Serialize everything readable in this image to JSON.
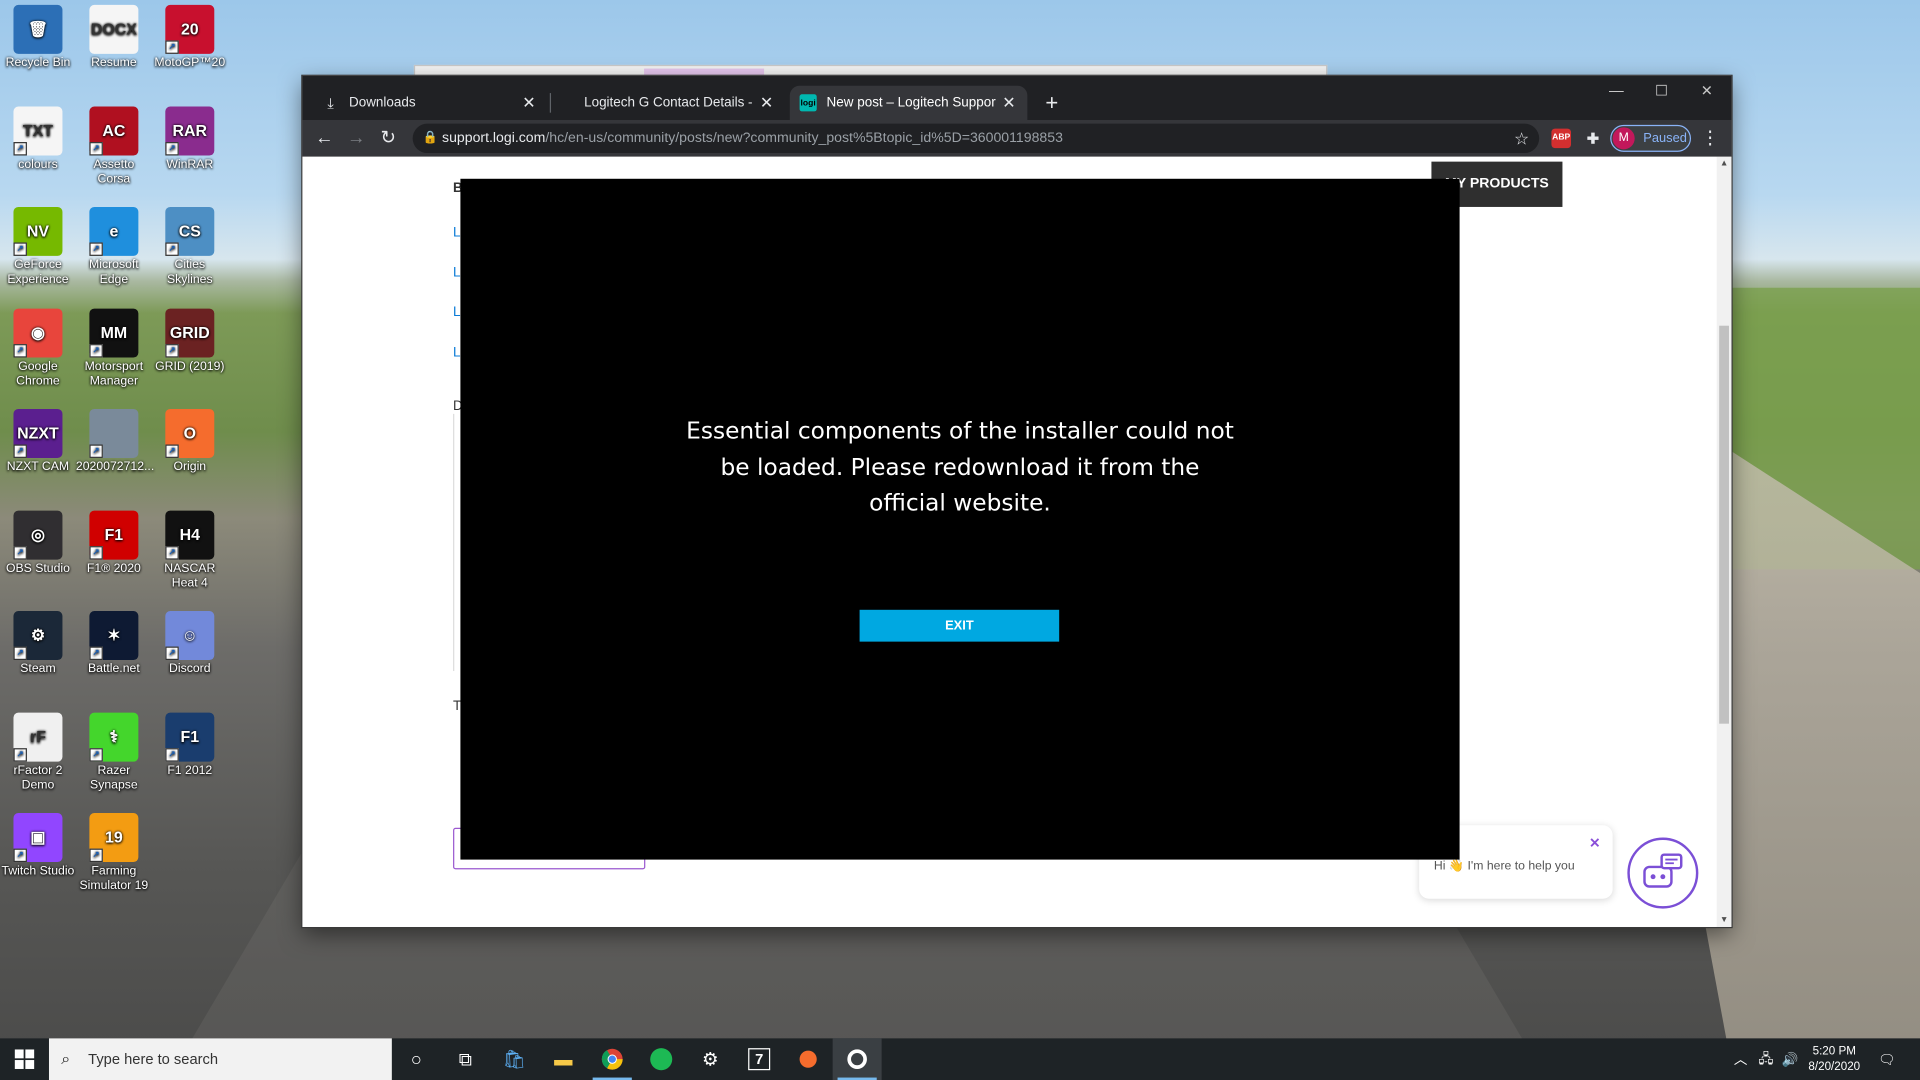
{
  "desktop": {
    "icons": [
      {
        "label": "Recycle Bin",
        "glyph": "🗑",
        "color": "#2c6fb6"
      },
      {
        "label": "Resume",
        "glyph": "DOCX",
        "color": "#f5f5f5"
      },
      {
        "label": "MotoGP™20",
        "glyph": "20",
        "color": "#c8102e"
      },
      {
        "label": "colours",
        "glyph": "TXT",
        "color": "#f5f5f5"
      },
      {
        "label": "Assetto Corsa",
        "glyph": "AC",
        "color": "#b01020"
      },
      {
        "label": "WinRAR",
        "glyph": "RAR",
        "color": "#8a2c8e"
      },
      {
        "label": "GeForce Experience",
        "glyph": "NV",
        "color": "#76b900"
      },
      {
        "label": "Microsoft Edge",
        "glyph": "e",
        "color": "#1f8fdd"
      },
      {
        "label": "Cities Skylines",
        "glyph": "CS",
        "color": "#4d8fc4"
      },
      {
        "label": "Google Chrome",
        "glyph": "◉",
        "color": "#e8453c"
      },
      {
        "label": "Motorsport Manager",
        "glyph": "MM",
        "color": "#111111"
      },
      {
        "label": "GRID (2019)",
        "glyph": "GRID",
        "color": "#6b2222"
      },
      {
        "label": "NZXT CAM",
        "glyph": "NZXT",
        "color": "#5b1f8f"
      },
      {
        "label": "2020072712...",
        "glyph": "",
        "color": "#7a8a9a"
      },
      {
        "label": "Origin",
        "glyph": "O",
        "color": "#f56c2d"
      },
      {
        "label": "OBS Studio",
        "glyph": "◎",
        "color": "#302e31"
      },
      {
        "label": "F1® 2020",
        "glyph": "F1",
        "color": "#d00000"
      },
      {
        "label": "NASCAR Heat 4",
        "glyph": "H4",
        "color": "#111111"
      },
      {
        "label": "Steam",
        "glyph": "⚙",
        "color": "#1b2838"
      },
      {
        "label": "Battle.net",
        "glyph": "✶",
        "color": "#0e1a33"
      },
      {
        "label": "Discord",
        "glyph": "☺",
        "color": "#7289da"
      },
      {
        "label": "rFactor 2 Demo",
        "glyph": "rF",
        "color": "#f0f0f0"
      },
      {
        "label": "Razer Synapse",
        "glyph": "⚕",
        "color": "#44d62c"
      },
      {
        "label": "F1 2012",
        "glyph": "F1",
        "color": "#1a3d6e"
      },
      {
        "label": "Twitch Studio",
        "glyph": "▣",
        "color": "#9146ff"
      },
      {
        "label": "Farming Simulator 19",
        "glyph": "19",
        "color": "#f39c12"
      }
    ]
  },
  "browser": {
    "tabs": [
      {
        "label": "Downloads",
        "icon": "download-icon",
        "active": false
      },
      {
        "label": "Logitech G Contact Details - Corp",
        "icon": "",
        "active": false
      },
      {
        "label": "New post – Logitech Support + D",
        "icon": "logi-icon",
        "active": true
      }
    ],
    "new_tab_symbol": "+",
    "window_controls": {
      "minimize": "—",
      "maximize": "☐",
      "close": "✕"
    },
    "address": {
      "host": "support.logi.com",
      "path": "/hc/en-us/community/posts/new?community_post%5Btopic_id%5D=360001198853"
    },
    "profile": {
      "initial": "M",
      "status": "Paused"
    },
    "extensions": [
      {
        "name": "adblock",
        "label": "ABP"
      },
      {
        "name": "puzzle",
        "label": "✦"
      }
    ]
  },
  "page": {
    "my_products_button": "MY PRODUCTS",
    "fragments": {
      "b": "B",
      "d": "D",
      "t": "T",
      "links": [
        "L",
        "L",
        "L",
        "L"
      ]
    },
    "chat": {
      "greeting": "Hi 👋 I'm here to help you",
      "close": "✕"
    }
  },
  "installer": {
    "message": "Essential components of the installer could not be loaded. Please redownload it from the official website.",
    "exit_label": "EXIT"
  },
  "taskbar": {
    "search_placeholder": "Type here to search",
    "pinned": [
      "cortana",
      "task-view",
      "store",
      "file-explorer",
      "chrome",
      "spotify",
      "steam",
      "7zip",
      "origin",
      "logitech-g-hub"
    ],
    "time": "5:20 PM",
    "date": "8/20/2020"
  }
}
